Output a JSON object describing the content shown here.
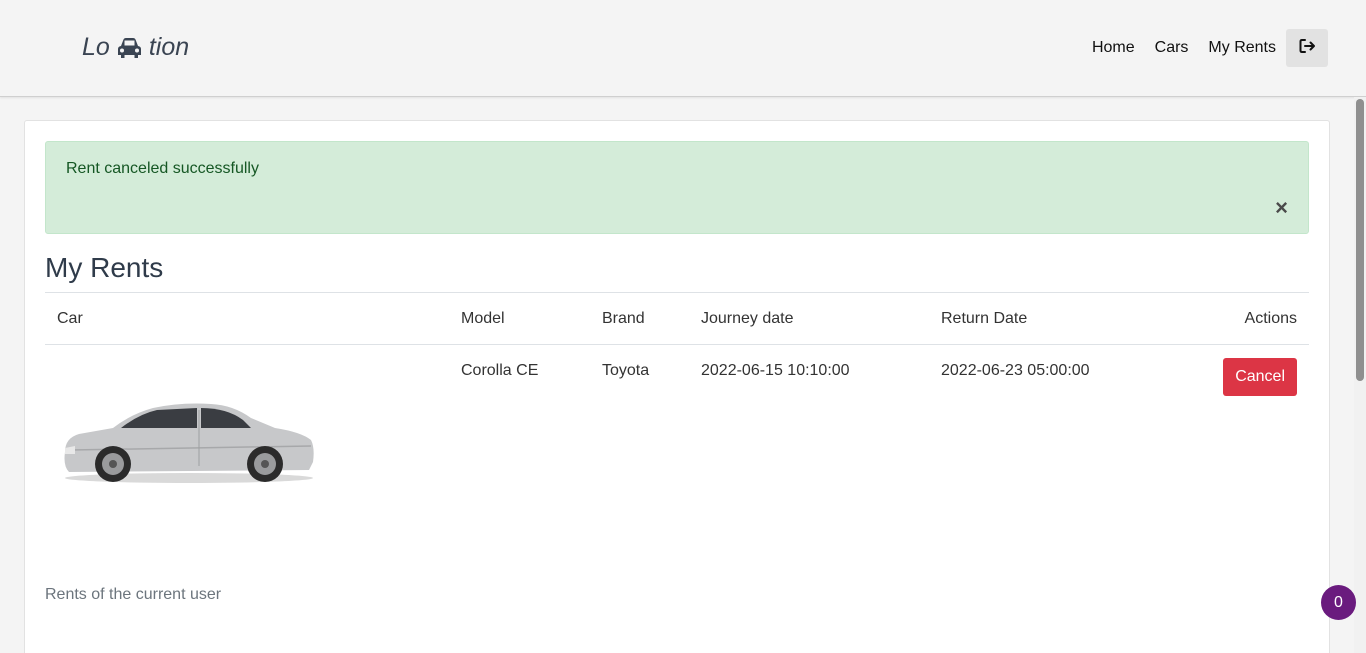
{
  "brand": {
    "prefix": "Lo",
    "suffix": "tion",
    "icon": "car-icon"
  },
  "nav": {
    "links": [
      "Home",
      "Cars",
      "My Rents"
    ],
    "logout_icon": "logout-icon"
  },
  "alert": {
    "message": "Rent canceled successfully",
    "close_label": "×"
  },
  "page_title": "My Rents",
  "table": {
    "headers": [
      "Car",
      "Model",
      "Brand",
      "Journey date",
      "Return Date",
      "Actions"
    ],
    "rows": [
      {
        "car_image": "silver-sedan-image",
        "model": "Corolla CE",
        "brand": "Toyota",
        "journey_date": "2022-06-15 10:10:00",
        "return_date": "2022-06-23 05:00:00",
        "action_label": "Cancel"
      }
    ]
  },
  "caption": "Rents of the current user",
  "badge_count": "0",
  "colors": {
    "danger": "#dc3545",
    "success_bg": "#d4ecd9",
    "success_text": "#155724",
    "badge": "#6a1b7e"
  }
}
